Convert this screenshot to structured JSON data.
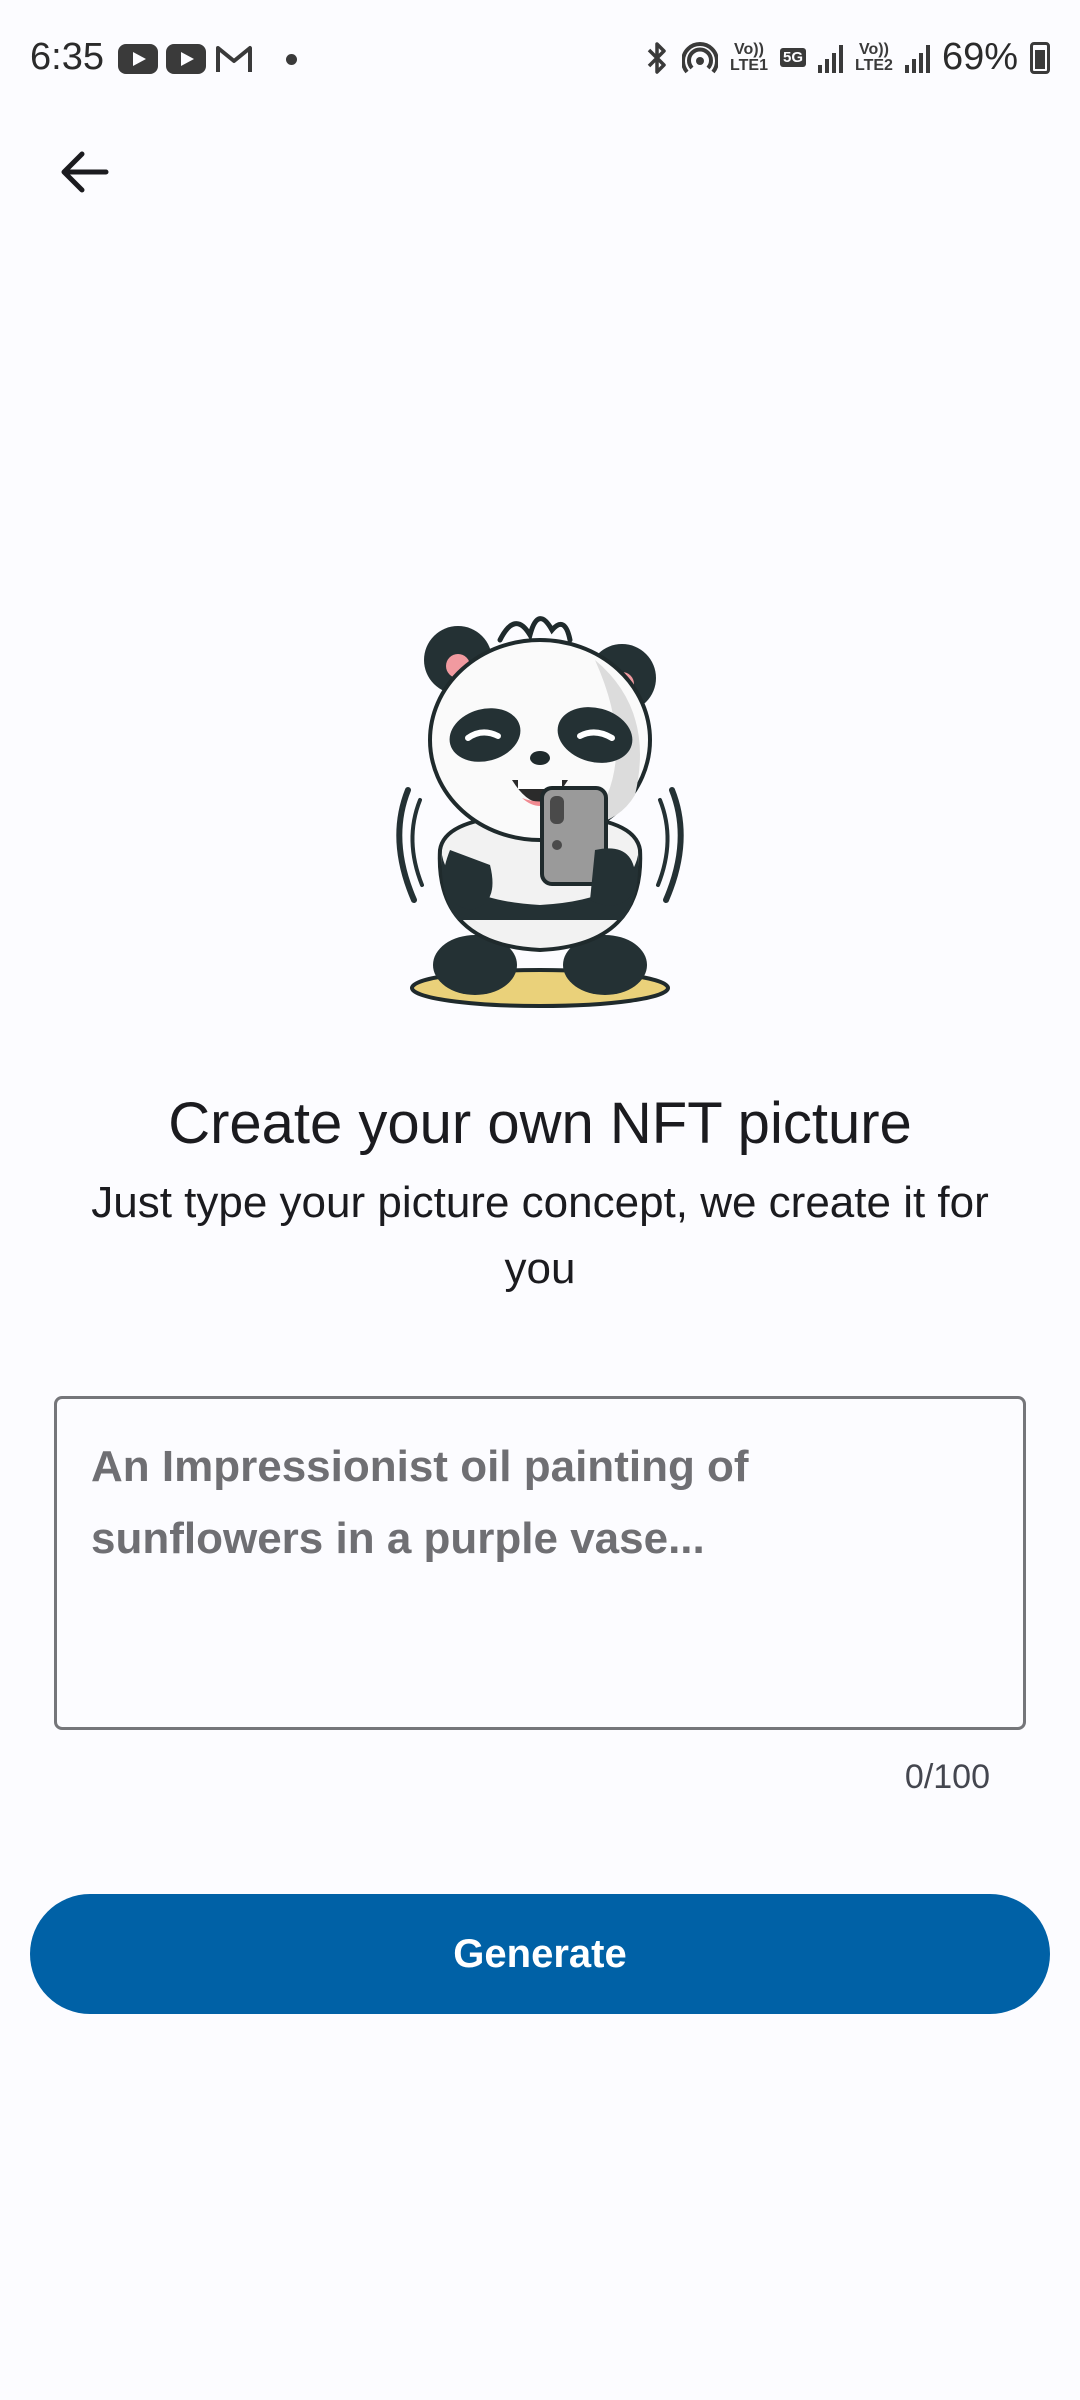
{
  "status_bar": {
    "time": "6:35",
    "volte1_top": "Vo))",
    "volte1_bottom": "LTE1",
    "network": "5G",
    "volte2_top": "Vo))",
    "volte2_bottom": "LTE2",
    "battery": "69%",
    "left_icons": [
      "youtube-icon",
      "youtube-icon",
      "gmail-icon",
      "dot-icon"
    ],
    "right_icons": [
      "bluetooth-icon",
      "hotspot-icon",
      "signal-icon",
      "signal-icon",
      "battery-icon"
    ]
  },
  "header": {
    "back_icon": "arrow-left-icon"
  },
  "hero": {
    "illustration": "panda-holding-phone-illustration",
    "title": "Create your own NFT picture",
    "subtitle": "Just type your picture concept, we create it for you"
  },
  "prompt": {
    "value": "",
    "placeholder": "An Impressionist oil painting of sunflowers in a purple vase...",
    "counter": "0/100"
  },
  "actions": {
    "generate_label": "Generate"
  },
  "colors": {
    "background": "#fcfcff",
    "primary": "#0061a6",
    "outline": "#75767a",
    "text": "#1b1b1f"
  }
}
